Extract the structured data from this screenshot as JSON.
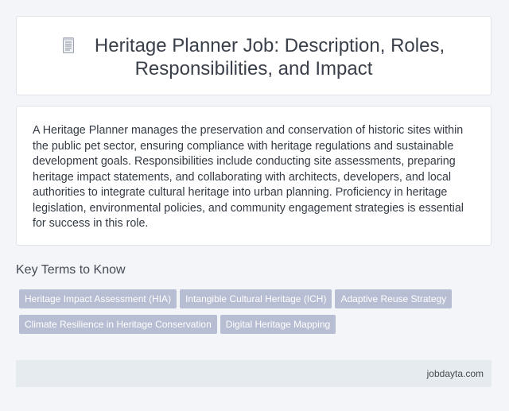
{
  "header": {
    "icon": "document-icon",
    "title": "Heritage Planner Job: Description, Roles, Responsibilities, and Impact"
  },
  "description": {
    "text": "A Heritage Planner manages the preservation and conservation of historic sites within the public pet sector, ensuring compliance with heritage regulations and sustainable development goals. Responsibilities include conducting site assessments, preparing heritage impact statements, and collaborating with architects, developers, and local authorities to integrate cultural heritage into urban planning. Proficiency in heritage legislation, environmental policies, and community engagement strategies is essential for success in this role."
  },
  "key_terms": {
    "heading": "Key Terms to Know",
    "tags": [
      "Heritage Impact Assessment (HIA)",
      "Intangible Cultural Heritage (ICH)",
      "Adaptive Reuse Strategy",
      "Climate Resilience in Heritage Conservation",
      "Digital Heritage Mapping"
    ]
  },
  "footer": {
    "site": "jobdayta.com"
  },
  "colors": {
    "background": "#f4f5f9",
    "card": "#ffffff",
    "tag_bg": "#b7bdd2",
    "footer_bg": "#e6ebef"
  }
}
